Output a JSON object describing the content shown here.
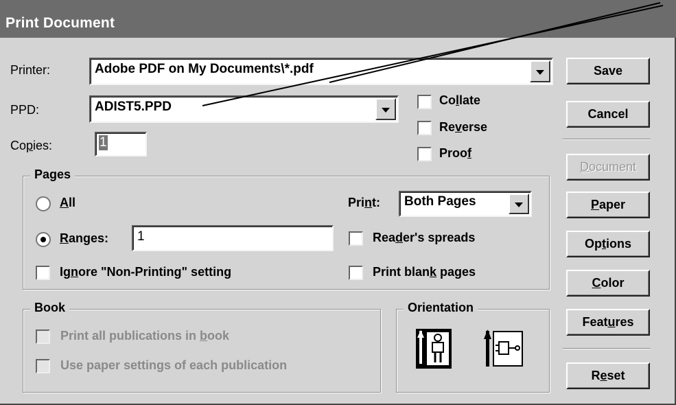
{
  "window": {
    "title": "Print Document"
  },
  "printer": {
    "label": "Printer:",
    "value": "Adobe PDF on My Documents\\*.pdf"
  },
  "ppd": {
    "label": "PPD:",
    "value": "ADIST5.PPD"
  },
  "copies": {
    "label": "Copies:",
    "value": "1"
  },
  "options": {
    "collate": {
      "label": "Collate",
      "checked": false
    },
    "reverse": {
      "label": "Reverse",
      "checked": false
    },
    "proof": {
      "label": "Proof",
      "checked": false
    }
  },
  "pages": {
    "title": "Pages",
    "all_label": "All",
    "ranges_label": "Ranges:",
    "ranges_value": "1",
    "selected": "ranges",
    "ignore_label": "Ignore \"Non-Printing\" setting",
    "print_label": "Print:",
    "print_value": "Both Pages",
    "readers_spreads_label": "Reader's spreads",
    "blank_pages_label": "Print blank pages"
  },
  "book": {
    "title": "Book",
    "print_all_label": "Print all publications in book",
    "use_paper_label": "Use paper settings of each publication"
  },
  "orientation": {
    "title": "Orientation",
    "icons": [
      "portrait-orientation-icon",
      "landscape-orientation-icon"
    ]
  },
  "buttons": {
    "save": "Save",
    "cancel": "Cancel",
    "document": "Document",
    "paper": "Paper",
    "options": "Options",
    "color": "Color",
    "features": "Features",
    "reset": "Reset"
  },
  "colors": {
    "titlebar": "#6c6c6c",
    "dialog": "#d4d4d4"
  }
}
